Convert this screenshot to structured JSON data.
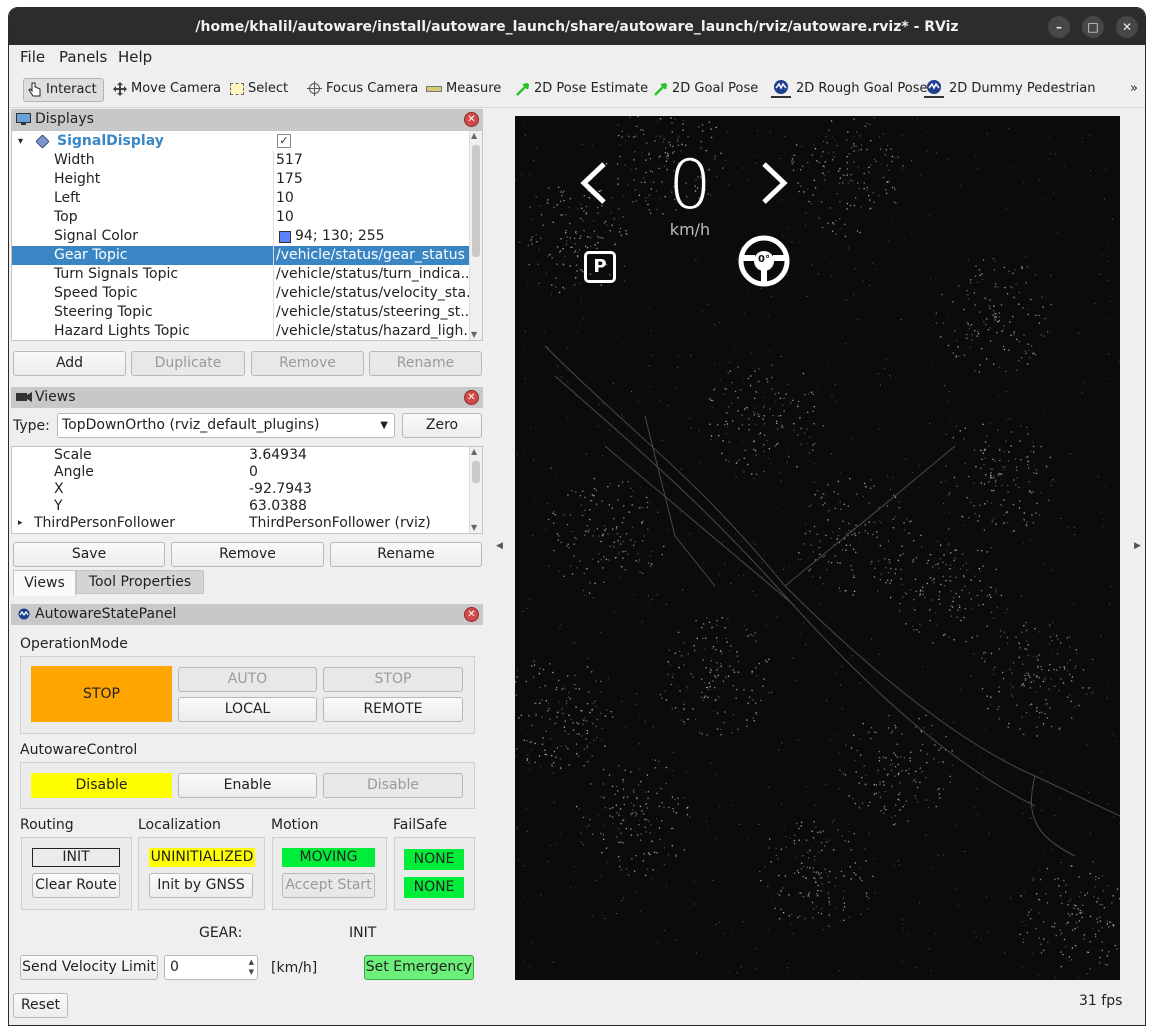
{
  "window": {
    "title": "/home/khalil/autoware/install/autoware_launch/share/autoware_launch/rviz/autoware.rviz* - RViz",
    "minimize": "–",
    "maximize": "□",
    "close": "✕"
  },
  "menu": [
    "File",
    "Panels",
    "Help"
  ],
  "toolbar": {
    "interact": "Interact",
    "move_camera": "Move Camera",
    "select": "Select",
    "focus_camera": "Focus Camera",
    "measure": "Measure",
    "pose_estimate": "2D Pose Estimate",
    "goal_pose": "2D Goal Pose",
    "rough_goal": "2D Rough Goal Pose",
    "dummy_ped": "2D Dummy Pedestrian",
    "more": "»"
  },
  "displays": {
    "title": "Displays",
    "root": {
      "name": "SignalDisplay",
      "checked": "✓"
    },
    "props": [
      {
        "k": "Width",
        "v": "517"
      },
      {
        "k": "Height",
        "v": "175"
      },
      {
        "k": "Left",
        "v": "10"
      },
      {
        "k": "Top",
        "v": "10"
      },
      {
        "k": "Signal Color",
        "v": "94; 130; 255",
        "color": "#5e82ff"
      },
      {
        "k": "Gear Topic",
        "v": "/vehicle/status/gear_status"
      },
      {
        "k": "Turn Signals Topic",
        "v": "/vehicle/status/turn_indica..."
      },
      {
        "k": "Speed Topic",
        "v": "/vehicle/status/velocity_sta..."
      },
      {
        "k": "Steering Topic",
        "v": "/vehicle/status/steering_st..."
      },
      {
        "k": "Hazard Lights Topic",
        "v": "/vehicle/status/hazard_ligh..."
      }
    ],
    "buttons": [
      "Add",
      "Duplicate",
      "Remove",
      "Rename"
    ]
  },
  "views": {
    "title": "Views",
    "type_label": "Type:",
    "type_value": "TopDownOrtho (rviz_default_plugins)",
    "zero": "Zero",
    "props": [
      {
        "k": "Scale",
        "v": "3.64934"
      },
      {
        "k": "Angle",
        "v": "0"
      },
      {
        "k": "X",
        "v": "-92.7943"
      },
      {
        "k": "Y",
        "v": "63.0388"
      },
      {
        "k": "ThirdPersonFollower",
        "v": "ThirdPersonFollower (rviz)"
      }
    ],
    "buttons": [
      "Save",
      "Remove",
      "Rename"
    ],
    "tabs": [
      "Views",
      "Tool Properties"
    ]
  },
  "state_panel": {
    "title": "AutowareStatePanel",
    "operation_mode": {
      "label": "OperationMode",
      "state": "STOP",
      "auto": "AUTO",
      "stop": "STOP",
      "local": "LOCAL",
      "remote": "REMOTE"
    },
    "control": {
      "label": "AutowareControl",
      "state": "Disable",
      "enable": "Enable",
      "disable": "Disable"
    },
    "routing": {
      "label": "Routing",
      "state": "INIT",
      "btn": "Clear Route"
    },
    "localization": {
      "label": "Localization",
      "state": "UNINITIALIZED",
      "btn": "Init by GNSS"
    },
    "motion": {
      "label": "Motion",
      "state": "MOVING",
      "btn": "Accept Start"
    },
    "failsafe": {
      "label": "FailSafe",
      "state1": "NONE",
      "state2": "NONE"
    },
    "gear_label": "GEAR:",
    "gear_value": "INIT",
    "velocity_btn": "Send Velocity Limit",
    "velocity_value": "0",
    "unit": "[km/h]",
    "emergency": "Set Emergency"
  },
  "reset": "Reset",
  "fps": "31 fps",
  "overlay": {
    "speed": "0",
    "unit": "km/h",
    "gear": "P",
    "steering": "0°"
  },
  "colors": {
    "stop": "#ffa500",
    "yellow": "#ffff00",
    "green": "#00ee3a",
    "emergency_green": "#6df07a",
    "selection": "#3a86c5",
    "overlay": "#ffffff"
  }
}
